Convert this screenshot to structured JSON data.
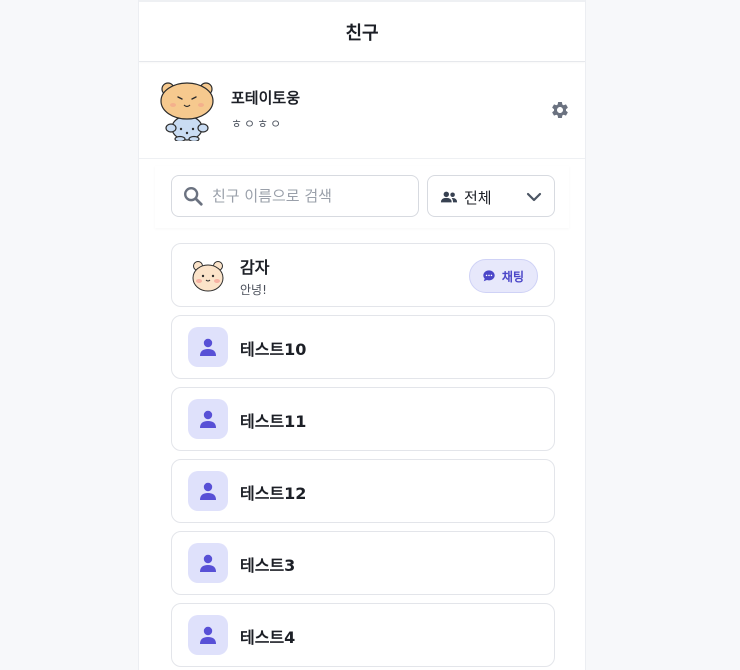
{
  "header": {
    "title": "친구"
  },
  "profile": {
    "name": "포테이토웅",
    "status": "ㅎㅇㅎㅇ",
    "settings_icon": "gear-icon"
  },
  "search": {
    "placeholder": "친구 이름으로 검색",
    "value": ""
  },
  "filter": {
    "selected": "전체",
    "icon": "users-icon"
  },
  "friends": [
    {
      "name": "감자",
      "status": "안녕!",
      "avatar": "bear",
      "chat_label": "채팅"
    },
    {
      "name": "테스트10",
      "avatar": "default-user"
    },
    {
      "name": "테스트11",
      "avatar": "default-user"
    },
    {
      "name": "테스트12",
      "avatar": "default-user"
    },
    {
      "name": "테스트3",
      "avatar": "default-user"
    },
    {
      "name": "테스트4",
      "avatar": "default-user"
    }
  ],
  "colors": {
    "accent": "#4b46c8",
    "accent_light": "#e7e8fb",
    "avatar_bg": "#dfe1fb",
    "user_icon": "#5850d6"
  }
}
